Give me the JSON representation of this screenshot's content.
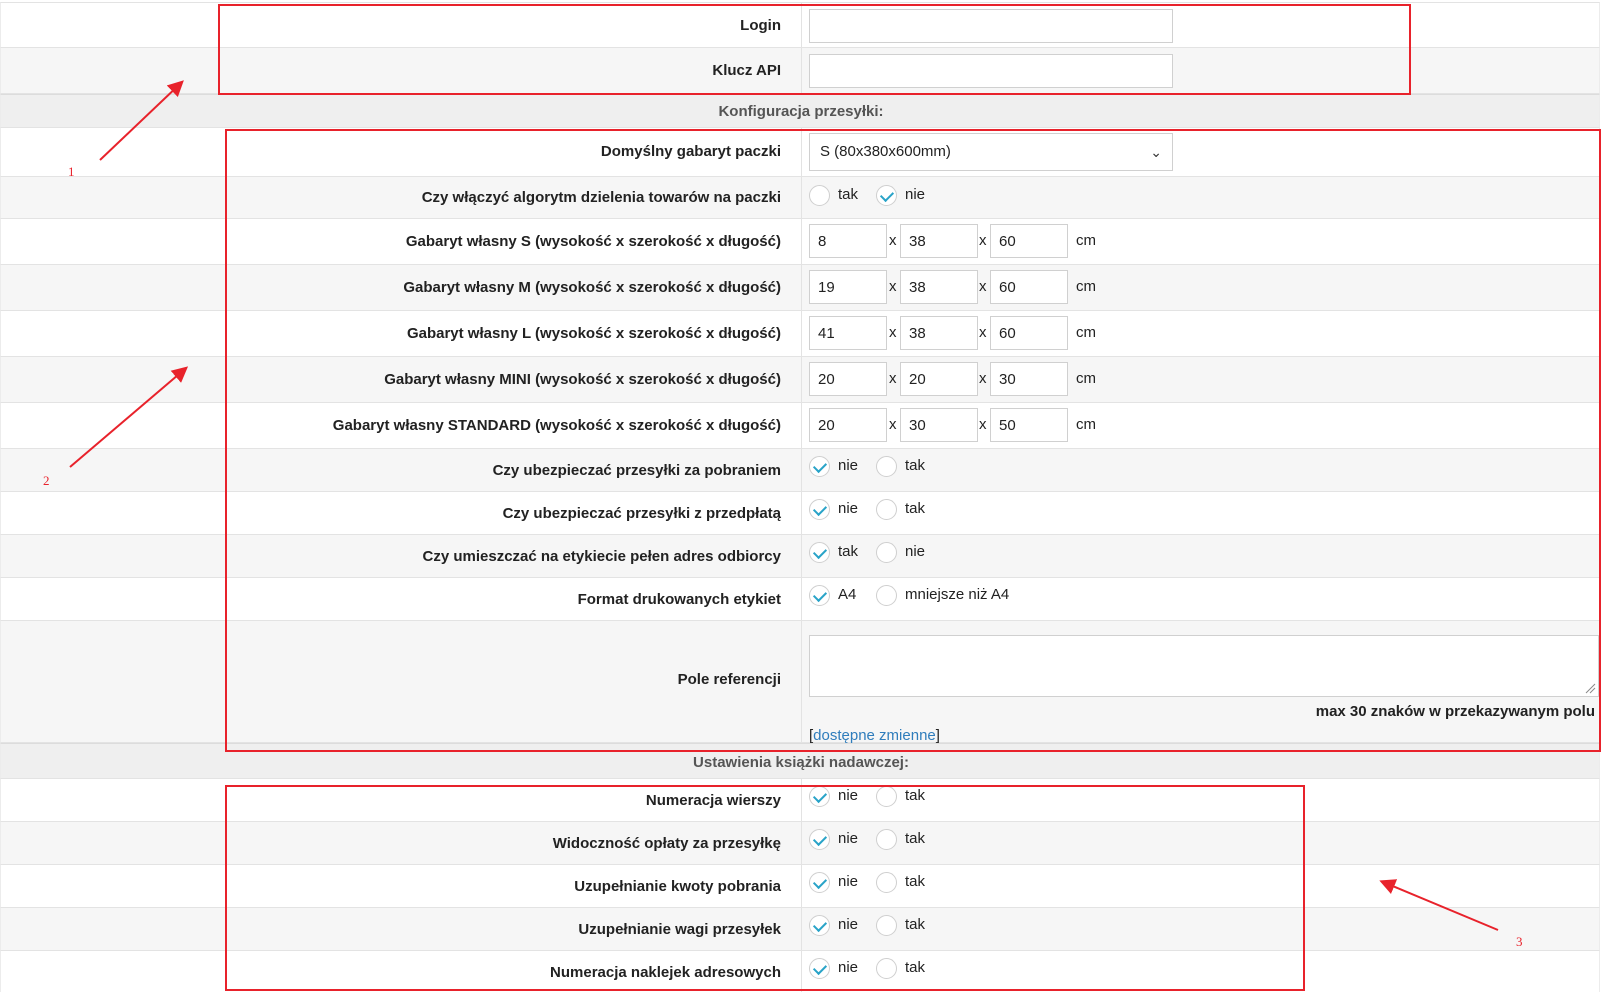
{
  "credentials": {
    "login_label": "Login",
    "login_value": "",
    "api_key_label": "Klucz API",
    "api_key_value": ""
  },
  "shipment": {
    "section_title": "Konfiguracja przesyłki:",
    "default_size_label": "Domyślny gabaryt paczki",
    "default_size_value": "S (80x380x600mm)",
    "split_algorithm": {
      "label": "Czy włączyć algorytm dzielenia towarów na paczki",
      "options": [
        "tak",
        "nie"
      ],
      "selected": "nie"
    },
    "custom_sizes": [
      {
        "label": "Gabaryt własny S (wysokość x szerokość x długość)",
        "h": "8",
        "w": "38",
        "l": "60"
      },
      {
        "label": "Gabaryt własny M (wysokość x szerokość x długość)",
        "h": "19",
        "w": "38",
        "l": "60"
      },
      {
        "label": "Gabaryt własny L (wysokość x szerokość x długość)",
        "h": "41",
        "w": "38",
        "l": "60"
      },
      {
        "label": "Gabaryt własny MINI (wysokość x szerokość x długość)",
        "h": "20",
        "w": "20",
        "l": "30"
      },
      {
        "label": "Gabaryt własny STANDARD (wysokość x szerokość x długość)",
        "h": "20",
        "w": "30",
        "l": "50"
      }
    ],
    "separator": "x",
    "unit": "cm",
    "insure_cod": {
      "label": "Czy ubezpieczać przesyłki za pobraniem",
      "options": [
        "nie",
        "tak"
      ],
      "selected": "nie"
    },
    "insure_prepaid": {
      "label": "Czy ubezpieczać przesyłki z przedpłatą",
      "options": [
        "nie",
        "tak"
      ],
      "selected": "nie"
    },
    "full_address": {
      "label": "Czy umieszczać na etykiecie pełen adres odbiorcy",
      "options": [
        "tak",
        "nie"
      ],
      "selected": "tak"
    },
    "label_format": {
      "label": "Format drukowanych etykiet",
      "options": [
        "A4",
        "mniejsze niż A4"
      ],
      "selected": "A4"
    },
    "reference": {
      "label": "Pole referencji",
      "value": "",
      "hint": "max 30 znaków w przekazywanym polu",
      "link_open": "[",
      "link_text": "dostępne zmienne",
      "link_close": "]"
    }
  },
  "sender_book": {
    "section_title": "Ustawienia książki nadawczej:",
    "items": [
      {
        "label": "Numeracja wierszy",
        "options": [
          "nie",
          "tak"
        ],
        "selected": "nie"
      },
      {
        "label": "Widoczność opłaty za przesyłkę",
        "options": [
          "nie",
          "tak"
        ],
        "selected": "nie"
      },
      {
        "label": "Uzupełnianie kwoty pobrania",
        "options": [
          "nie",
          "tak"
        ],
        "selected": "nie"
      },
      {
        "label": "Uzupełnianie wagi przesyłek",
        "options": [
          "nie",
          "tak"
        ],
        "selected": "nie"
      },
      {
        "label": "Numeracja naklejek adresowych",
        "options": [
          "nie",
          "tak"
        ],
        "selected": "nie"
      }
    ]
  },
  "annotations": {
    "color": "#e8222b",
    "numbers": [
      "1",
      "2",
      "3"
    ]
  }
}
